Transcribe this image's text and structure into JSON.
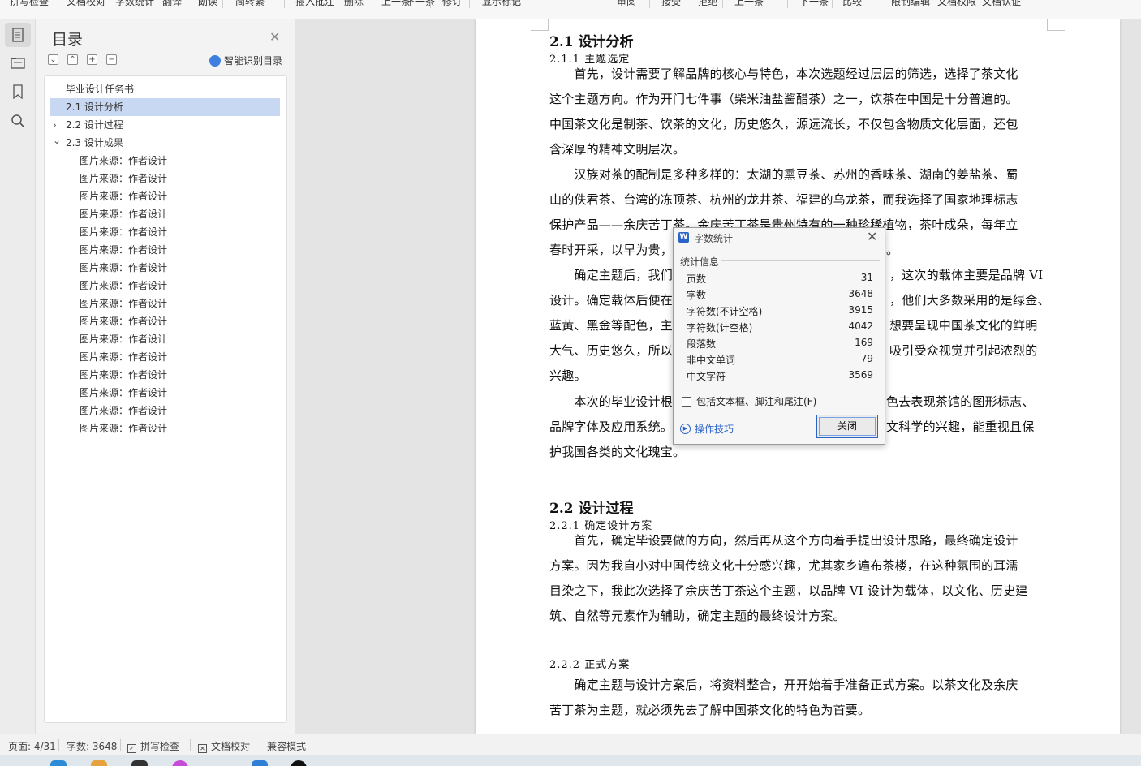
{
  "ribbon": {
    "items": [
      "拼写检查",
      "文档校对",
      "字数统计",
      "翻译",
      "朗读",
      "简转繁",
      "插入批注",
      "删除",
      "上一条",
      "下一条",
      "修订",
      "显示标记",
      "审阅",
      "接受",
      "拒绝",
      "上一条",
      "下一条",
      "比较",
      "限制编辑",
      "文档权限",
      "文档认证"
    ]
  },
  "rail": {
    "icons": [
      "document-icon",
      "navigation-icon",
      "bookmark-icon",
      "search-icon"
    ]
  },
  "toc": {
    "title": "目录",
    "smart_label": "智能识别目录",
    "items": [
      {
        "label": "毕业设计任务书",
        "level": 1,
        "selected": false,
        "expander": ""
      },
      {
        "label": "2.1 设计分析",
        "level": 1,
        "selected": true,
        "expander": ""
      },
      {
        "label": "2.2 设计过程",
        "level": 1,
        "selected": false,
        "expander": "collapsed"
      },
      {
        "label": "2.3 设计成果",
        "level": 1,
        "selected": false,
        "expander": "expanded"
      },
      {
        "label": "图片来源：作者设计",
        "level": 2
      },
      {
        "label": "图片来源：作者设计",
        "level": 2
      },
      {
        "label": "图片来源：作者设计",
        "level": 2
      },
      {
        "label": "图片来源：作者设计",
        "level": 2
      },
      {
        "label": "图片来源：作者设计",
        "level": 2
      },
      {
        "label": "图片来源：作者设计",
        "level": 2
      },
      {
        "label": "图片来源：作者设计",
        "level": 2
      },
      {
        "label": "图片来源：作者设计",
        "level": 2
      },
      {
        "label": "图片来源：作者设计",
        "level": 2
      },
      {
        "label": "图片来源：作者设计",
        "level": 2
      },
      {
        "label": "图片来源：作者设计",
        "level": 2
      },
      {
        "label": "图片来源：作者设计",
        "level": 2
      },
      {
        "label": "图片来源：作者设计",
        "level": 2
      },
      {
        "label": "图片来源：作者设计",
        "level": 2
      },
      {
        "label": "图片来源：作者设计",
        "level": 2
      },
      {
        "label": "图片来源：作者设计",
        "level": 2
      }
    ]
  },
  "document": {
    "blocks": [
      {
        "kind": "h2",
        "text": "2.1 设计分析"
      },
      {
        "kind": "h3",
        "text": "2.1.1 主题选定"
      },
      {
        "kind": "p",
        "text": "　　首先，设计需要了解品牌的核心与特色，本次选题经过层层的筛选，选择了茶文化"
      },
      {
        "kind": "p",
        "text": "这个主题方向。作为开门七件事（柴米油盐酱醋茶）之一，饮茶在中国是十分普遍的。"
      },
      {
        "kind": "p",
        "text": "中国茶文化是制茶、饮茶的文化，历史悠久，源远流长，不仅包含物质文化层面，还包"
      },
      {
        "kind": "p",
        "text": "含深厚的精神文明层次。"
      },
      {
        "kind": "p",
        "text": "　　汉族对茶的配制是多种多样的：太湖的熏豆茶、苏州的香味茶、湖南的姜盐茶、蜀"
      },
      {
        "kind": "p",
        "text": "山的佚君茶、台湾的冻顶茶、杭州的龙井茶、福建的乌龙茶，而我选择了国家地理标志"
      },
      {
        "kind": "p",
        "text": "保护产品——余庆苦丁茶。余庆苦丁茶是贵州特有的一种珍稀植物，茶叶成朵，每年立"
      },
      {
        "kind": "p",
        "text": "春时开采，以早为贵，"
      },
      {
        "kind": "p",
        "text": "　　确定主题后，我们"
      },
      {
        "kind": "p",
        "text": "设计。确定载体后便在"
      },
      {
        "kind": "p",
        "text": "蓝黄、黑金等配色，主"
      },
      {
        "kind": "p",
        "text": "大气、历史悠久，所以"
      },
      {
        "kind": "p",
        "text": "兴趣。"
      },
      {
        "kind": "p",
        "text": "　　本次的毕业设计根"
      },
      {
        "kind": "p",
        "text": "品牌字体及应用系统。"
      },
      {
        "kind": "p",
        "text": "护我国各类的文化瑰宝。"
      },
      {
        "kind": "h2",
        "text": "2.2 设计过程"
      },
      {
        "kind": "h3",
        "text": "2.2.1 确定设计方案"
      },
      {
        "kind": "p",
        "text": "　　首先，确定毕设要做的方向，然后再从这个方向着手提出设计思路，最终确定设计"
      },
      {
        "kind": "p",
        "text": "方案。因为我自小对中国传统文化十分感兴趣，尤其家乡遍布茶楼，在这种氛围的耳濡"
      },
      {
        "kind": "p",
        "text": "目染之下，我此次选择了余庆苦丁茶这个主题，以品牌 VI 设计为载体，以文化、历史建"
      },
      {
        "kind": "p",
        "text": "筑、自然等元素作为辅助，确定主题的最终设计方案。"
      },
      {
        "kind": "h3",
        "text": "2.2.2 正式方案"
      },
      {
        "kind": "p",
        "text": "　　确定主题与设计方案后，将资料整合，开开始着手准备正式方案。以茶文化及余庆"
      },
      {
        "kind": "p",
        "text": "苦丁茶为主题，就必须先去了解中国茶文化的特色为首要。"
      }
    ],
    "right_fragments": [
      "。",
      "，这次的载体主要是品牌 VI",
      "，他们大多数采用的是绿金、",
      "想要呈现中国茶文化的鲜明",
      "吸引受众视觉并引起浓烈的",
      "色去表现茶馆的图形标志、",
      "文科学的兴趣，能重视且保"
    ]
  },
  "dialog": {
    "title": "字数统计",
    "section": "统计信息",
    "stats": [
      {
        "label": "页数",
        "value": "31"
      },
      {
        "label": "字数",
        "value": "3648"
      },
      {
        "label": "字符数(不计空格)",
        "value": "3915"
      },
      {
        "label": "字符数(计空格)",
        "value": "4042"
      },
      {
        "label": "段落数",
        "value": "169"
      },
      {
        "label": "非中文单词",
        "value": "79"
      },
      {
        "label": "中文字符",
        "value": "3569"
      }
    ],
    "checkbox_label": "包括文本框、脚注和尾注(F)",
    "checkbox_checked": false,
    "tips_label": "操作技巧",
    "close_label": "关闭"
  },
  "status": {
    "page": "页面: 4/31",
    "words": "字数: 3648",
    "spell": "拼写检查",
    "proof": "文档校对",
    "compat": "兼容模式"
  },
  "colors": {
    "accent": "#2b63c9",
    "toc_selected": "#c9d8f2"
  }
}
